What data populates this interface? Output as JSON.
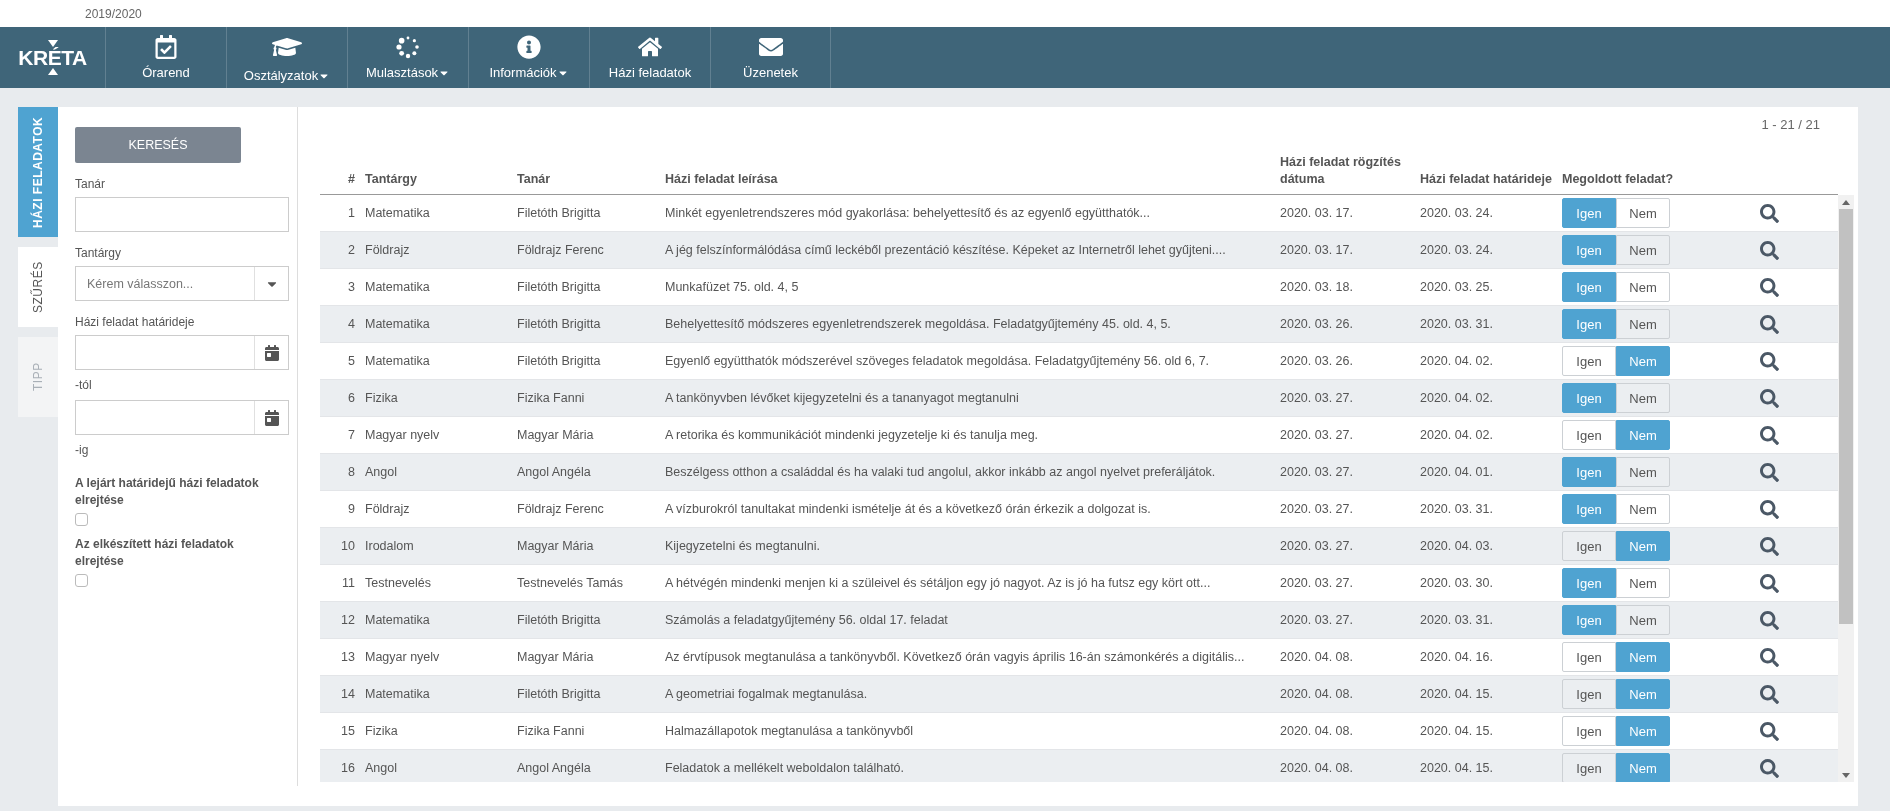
{
  "header": {
    "school_year": "2019/2020"
  },
  "nav": {
    "logo": "KRÉTA",
    "items": [
      {
        "label": "Órarend",
        "kind": "calendar",
        "dropdown": false
      },
      {
        "label": "Osztályzatok",
        "kind": "cap",
        "dropdown": true
      },
      {
        "label": "Mulasztások",
        "kind": "dots",
        "dropdown": true
      },
      {
        "label": "Információk",
        "kind": "info",
        "dropdown": true
      },
      {
        "label": "Házi feladatok",
        "kind": "home",
        "dropdown": false
      },
      {
        "label": "Üzenetek",
        "kind": "envelope",
        "dropdown": false
      }
    ]
  },
  "side_tabs": [
    {
      "label": "HÁZI FELADATOK",
      "selected": true,
      "disabled": false
    },
    {
      "label": "SZŰRÉS",
      "selected": false,
      "disabled": false
    },
    {
      "label": "TIPP",
      "selected": false,
      "disabled": true
    }
  ],
  "filter": {
    "search_button": "KERESÉS",
    "fields": [
      {
        "kind": "text",
        "label": "Tanár"
      },
      {
        "kind": "select",
        "label": "Tantárgy",
        "placeholder": "Kérem válasszon..."
      },
      {
        "kind": "date",
        "label": "Házi feladat határideje",
        "suffix": "-tól"
      },
      {
        "kind": "date",
        "suffix": "-ig"
      }
    ],
    "checkboxes": [
      {
        "label": "A lejárt határidejű házi feladatok elrejtése",
        "checked": false
      },
      {
        "label": "Az elkészített házi feladatok elrejtése",
        "checked": false
      }
    ]
  },
  "pagination": "1 - 21 / 21",
  "table": {
    "columns": [
      "#",
      "Tantárgy",
      "Tanár",
      "Házi feladat leírása",
      "Házi feladat rögzítés dátuma",
      "Házi feladat határideje",
      "Megoldott feladat?"
    ],
    "rows": [
      {
        "number": "1",
        "subject": "Matematika",
        "teacher": "Filetóth Brigitta",
        "description": "Minkét egyenletrendszeres mód gyakorlása: behelyettesítő és az egyenlő együtthatók...",
        "recorded": "2020. 03. 17.",
        "deadline": "2020. 03. 24.",
        "solved": [
          {
            "label": "Igen",
            "selected": true
          },
          {
            "label": "Nem",
            "selected": false
          }
        ]
      },
      {
        "number": "2",
        "subject": "Földrajz",
        "teacher": "Földrajz Ferenc",
        "description": "A jég felszínformálódása című leckéből prezentáció készítése. Képeket az Internetről lehet gyűjteni....",
        "recorded": "2020. 03. 17.",
        "deadline": "2020. 03. 24.",
        "solved": [
          {
            "label": "Igen",
            "selected": true
          },
          {
            "label": "Nem",
            "selected": false
          }
        ]
      },
      {
        "number": "3",
        "subject": "Matematika",
        "teacher": "Filetóth Brigitta",
        "description": "Munkafüzet 75. old. 4, 5",
        "recorded": "2020. 03. 18.",
        "deadline": "2020. 03. 25.",
        "solved": [
          {
            "label": "Igen",
            "selected": true
          },
          {
            "label": "Nem",
            "selected": false
          }
        ]
      },
      {
        "number": "4",
        "subject": "Matematika",
        "teacher": "Filetóth Brigitta",
        "description": "Behelyettesítő módszeres egyenletrendszerek megoldása. Feladatgyűjtemény 45. old. 4, 5.",
        "recorded": "2020. 03. 26.",
        "deadline": "2020. 03. 31.",
        "solved": [
          {
            "label": "Igen",
            "selected": true
          },
          {
            "label": "Nem",
            "selected": false
          }
        ]
      },
      {
        "number": "5",
        "subject": "Matematika",
        "teacher": "Filetóth Brigitta",
        "description": "Egyenlő együtthatók módszerével szöveges feladatok megoldása. Feladatgyűjtemény 56. old 6, 7.",
        "recorded": "2020. 03. 26.",
        "deadline": "2020. 04. 02.",
        "solved": [
          {
            "label": "Igen",
            "selected": false
          },
          {
            "label": "Nem",
            "selected": true
          }
        ]
      },
      {
        "number": "6",
        "subject": "Fizika",
        "teacher": "Fizika Fanni",
        "description": "A tankönyvben lévőket kijegyzetelni és a tananyagot megtanulni",
        "recorded": "2020. 03. 27.",
        "deadline": "2020. 04. 02.",
        "solved": [
          {
            "label": "Igen",
            "selected": true
          },
          {
            "label": "Nem",
            "selected": false
          }
        ]
      },
      {
        "number": "7",
        "subject": "Magyar nyelv",
        "teacher": "Magyar Mária",
        "description": "A retorika és kommunikációt mindenki jegyzetelje ki és tanulja meg.",
        "recorded": "2020. 03. 27.",
        "deadline": "2020. 04. 02.",
        "solved": [
          {
            "label": "Igen",
            "selected": false
          },
          {
            "label": "Nem",
            "selected": true
          }
        ]
      },
      {
        "number": "8",
        "subject": "Angol",
        "teacher": "Angol Angéla",
        "description": "Beszélgess otthon a családdal és ha valaki tud angolul, akkor inkább az angol nyelvet preferáljátok.",
        "recorded": "2020. 03. 27.",
        "deadline": "2020. 04. 01.",
        "solved": [
          {
            "label": "Igen",
            "selected": true
          },
          {
            "label": "Nem",
            "selected": false
          }
        ]
      },
      {
        "number": "9",
        "subject": "Földrajz",
        "teacher": "Földrajz Ferenc",
        "description": "A vízburokról tanultakat mindenki ismételje át és a következő órán érkezik a dolgozat is.",
        "recorded": "2020. 03. 27.",
        "deadline": "2020. 03. 31.",
        "solved": [
          {
            "label": "Igen",
            "selected": true
          },
          {
            "label": "Nem",
            "selected": false
          }
        ]
      },
      {
        "number": "10",
        "subject": "Irodalom",
        "teacher": "Magyar Mária",
        "description": "Kijegyzetelni és megtanulni.",
        "recorded": "2020. 03. 27.",
        "deadline": "2020. 04. 03.",
        "solved": [
          {
            "label": "Igen",
            "selected": false
          },
          {
            "label": "Nem",
            "selected": true
          }
        ]
      },
      {
        "number": "11",
        "subject": "Testnevelés",
        "teacher": "Testnevelés Tamás",
        "description": "A hétvégén mindenki menjen ki a szüleivel és sétáljon egy jó nagyot. Az is jó ha futsz egy kört ott...",
        "recorded": "2020. 03. 27.",
        "deadline": "2020. 03. 30.",
        "solved": [
          {
            "label": "Igen",
            "selected": true
          },
          {
            "label": "Nem",
            "selected": false
          }
        ]
      },
      {
        "number": "12",
        "subject": "Matematika",
        "teacher": "Filetóth Brigitta",
        "description": "Számolás a feladatgyűjtemény 56. oldal 17. feladat",
        "recorded": "2020. 03. 27.",
        "deadline": "2020. 03. 31.",
        "solved": [
          {
            "label": "Igen",
            "selected": true
          },
          {
            "label": "Nem",
            "selected": false
          }
        ]
      },
      {
        "number": "13",
        "subject": "Magyar nyelv",
        "teacher": "Magyar Mária",
        "description": "Az érvtípusok megtanulása a tankönyvből. Következő órán vagyis április 16-án számonkérés a digitális...",
        "recorded": "2020. 04. 08.",
        "deadline": "2020. 04. 16.",
        "solved": [
          {
            "label": "Igen",
            "selected": false
          },
          {
            "label": "Nem",
            "selected": true
          }
        ]
      },
      {
        "number": "14",
        "subject": "Matematika",
        "teacher": "Filetóth Brigitta",
        "description": "A geometriai fogalmak megtanulása.",
        "recorded": "2020. 04. 08.",
        "deadline": "2020. 04. 15.",
        "solved": [
          {
            "label": "Igen",
            "selected": false
          },
          {
            "label": "Nem",
            "selected": true
          }
        ]
      },
      {
        "number": "15",
        "subject": "Fizika",
        "teacher": "Fizika Fanni",
        "description": "Halmazállapotok megtanulása a tankönyvből",
        "recorded": "2020. 04. 08.",
        "deadline": "2020. 04. 15.",
        "solved": [
          {
            "label": "Igen",
            "selected": false
          },
          {
            "label": "Nem",
            "selected": true
          }
        ]
      },
      {
        "number": "16",
        "subject": "Angol",
        "teacher": "Angol Angéla",
        "description": "Feladatok a mellékelt weboldalon található.",
        "recorded": "2020. 04. 08.",
        "deadline": "2020. 04. 15.",
        "solved": [
          {
            "label": "Igen",
            "selected": false
          },
          {
            "label": "Nem",
            "selected": true
          }
        ]
      }
    ]
  }
}
